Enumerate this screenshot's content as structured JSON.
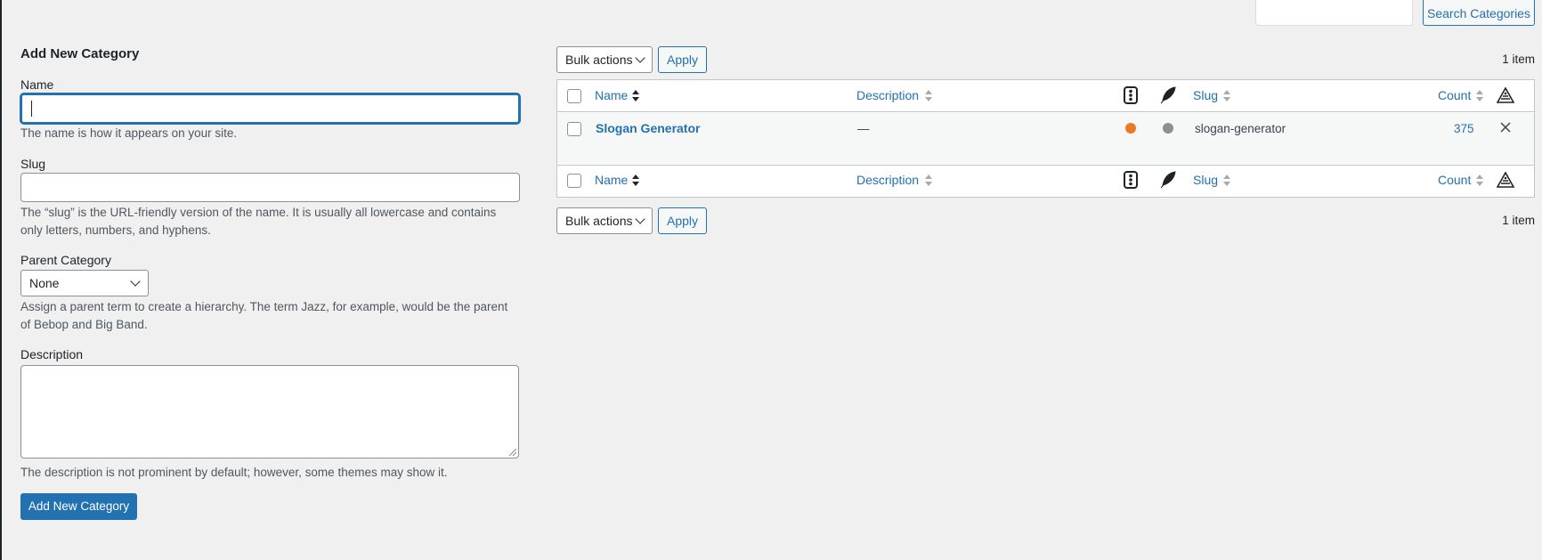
{
  "search": {
    "placeholder": "",
    "button_label": "Search Categories"
  },
  "form": {
    "title": "Add New Category",
    "name": {
      "label": "Name",
      "value": "",
      "help": "The name is how it appears on your site."
    },
    "slug": {
      "label": "Slug",
      "value": "",
      "help": "The “slug” is the URL-friendly version of the name. It is usually all lowercase and contains only letters, numbers, and hyphens."
    },
    "parent": {
      "label": "Parent Category",
      "selected": "None",
      "help": "Assign a parent term to create a hierarchy. The term Jazz, for example, would be the parent of Bebop and Big Band."
    },
    "description": {
      "label": "Description",
      "value": "",
      "help": "The description is not prominent by default; however, some themes may show it."
    },
    "submit_label": "Add New Category"
  },
  "tablenav": {
    "top": {
      "bulk_label": "Bulk actions",
      "apply_label": "Apply",
      "count": "1 item"
    },
    "bottom": {
      "bulk_label": "Bulk actions",
      "apply_label": "Apply",
      "count": "1 item"
    }
  },
  "table": {
    "columns": {
      "name": "Name",
      "description": "Description",
      "slug": "Slug",
      "count": "Count"
    },
    "rows": [
      {
        "name": "Slogan Generator",
        "description": "—",
        "status_colors": [
          "#e87b24",
          "#8c8f94"
        ],
        "slug": "slogan-generator",
        "count": "375"
      }
    ]
  }
}
